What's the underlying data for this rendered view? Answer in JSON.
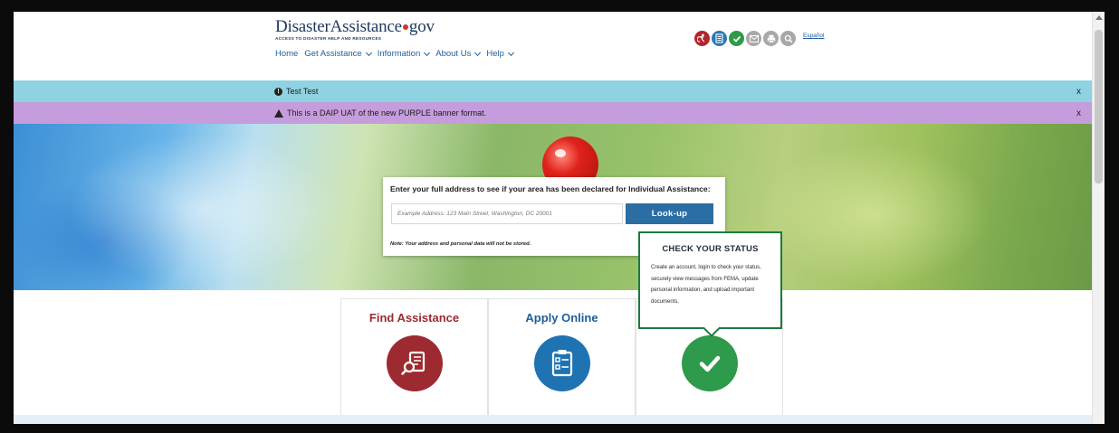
{
  "header": {
    "logo_main": "DisasterAssistance",
    "logo_suffix": "gov",
    "logo_tagline": "ACCESS TO DISASTER HELP AND RESOURCES",
    "nav": [
      {
        "label": "Home",
        "dropdown": false
      },
      {
        "label": "Get Assistance",
        "dropdown": true
      },
      {
        "label": "Information",
        "dropdown": true
      },
      {
        "label": "About Us",
        "dropdown": true
      },
      {
        "label": "Help",
        "dropdown": true
      }
    ],
    "language_link": "Español",
    "utility_icons": [
      {
        "name": "accessibility-icon",
        "color": "#b3262d"
      },
      {
        "name": "document-icon",
        "color": "#2b78b4"
      },
      {
        "name": "check-status-icon",
        "color": "#2f9a47"
      },
      {
        "name": "email-icon",
        "color": "#a8a8a8"
      },
      {
        "name": "print-icon",
        "color": "#a8a8a8"
      },
      {
        "name": "search-icon",
        "color": "#a8a8a8"
      }
    ]
  },
  "banners": {
    "info_text": "Test Test",
    "warning_text": "This is a DAIP UAT of the new PURPLE banner format.",
    "close_label": "x"
  },
  "lookup": {
    "title": "Enter your full address to see if your area has been declared for Individual Assistance:",
    "placeholder": "Example Address: 123 Main Street, Washington, DC 20001",
    "button_label": "Look-up",
    "note": "Note: Your address and personal data will not be stored."
  },
  "status_popup": {
    "title": "CHECK YOUR STATUS",
    "body": "Create an account, login to check your status, securely view messages from FEMA, update personal information, and upload important documents."
  },
  "cards": [
    {
      "title": "Find Assistance",
      "title_color": "#9c2a30",
      "icon": "search-document-icon",
      "icon_color": "#9c2a30"
    },
    {
      "title": "Apply Online",
      "title_color": "#1e5d99",
      "icon": "clipboard-checklist-icon",
      "icon_color": "#1f73b3"
    },
    {
      "title": "",
      "icon": "check-status-icon",
      "icon_color": "#2e9a4b"
    }
  ]
}
